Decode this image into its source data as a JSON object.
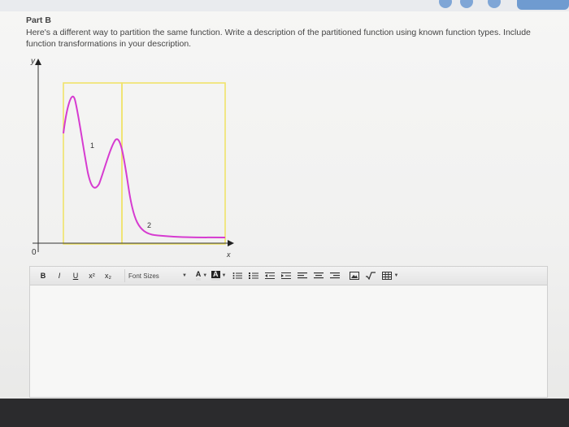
{
  "question": {
    "part_title": "Part B",
    "prompt": "Here's a different way to partition the same function. Write a description of the partitioned function using known function types. Include function transformations in your description."
  },
  "graph": {
    "y_axis_label": "y",
    "x_axis_label": "x",
    "origin_label": "0",
    "region_labels": [
      "1",
      "2"
    ],
    "curve_color": "#d63bd0",
    "partition_color": "#f0e36a"
  },
  "editor": {
    "toolbar": {
      "bold": "B",
      "italic": "I",
      "underline": "U",
      "superscript": "x²",
      "subscript": "x₂",
      "font_size": "Font Sizes",
      "font_color": "A",
      "highlight": "A"
    },
    "content": ""
  }
}
